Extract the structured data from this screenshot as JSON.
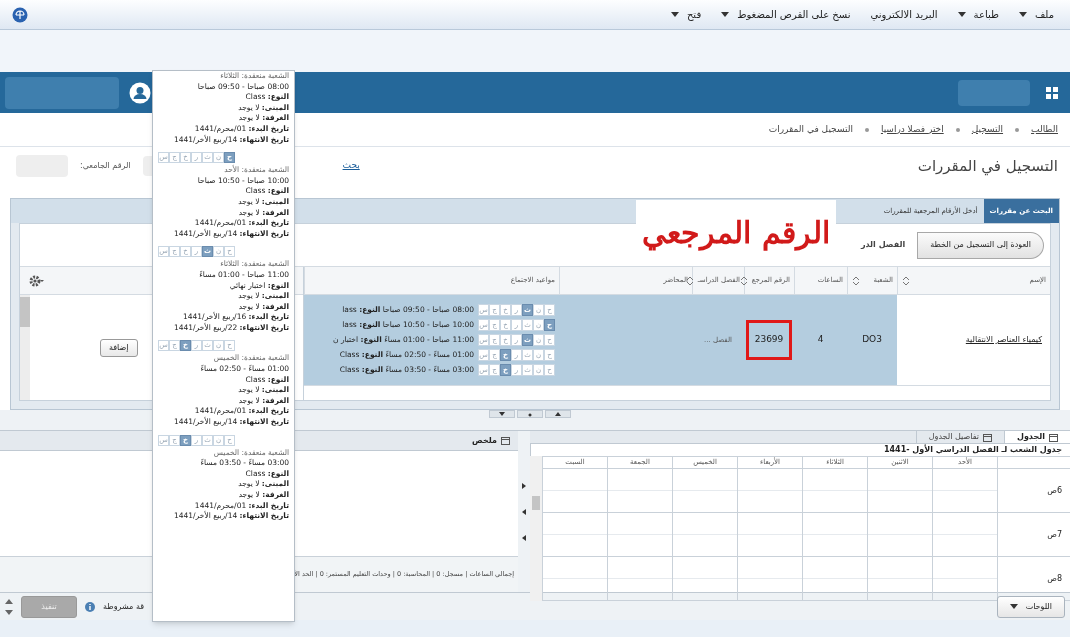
{
  "menu": [
    {
      "label": "ملف",
      "dropdown": true
    },
    {
      "label": "طباعة",
      "dropdown": true
    },
    {
      "label": "البريد الالكتروني",
      "dropdown": false
    },
    {
      "label": "نسخ على القرص المضغوط",
      "dropdown": true
    },
    {
      "label": "فتح",
      "dropdown": true
    }
  ],
  "breadcrumbs": [
    {
      "label": "الطالب",
      "link": true
    },
    {
      "label": "التسجيل",
      "link": true
    },
    {
      "label": "اختر فصلا دراسيا",
      "link": true
    },
    {
      "label": "التسجيل في المقررات",
      "link": false
    }
  ],
  "page_title": "التسجيل في المقررات",
  "student_id_label": "الرقم الجامعي:",
  "search_link": "بحث",
  "tabs": [
    {
      "label": "البحث عن مقررات",
      "selected": true
    },
    {
      "label": "أدخل الأرقام المرجعية للمقررات",
      "selected": false
    }
  ],
  "back_button": "العودة إلى التسجيل من الخطة",
  "term_label": "الفصل الدر",
  "annotation": "الرقم المرجعي",
  "table": {
    "columns": [
      "الإسم",
      "الشعبة",
      "الساعات",
      "الرقم المرجع",
      "الفصل الدراسـ",
      "المحاضر",
      "مواعيد الاجتماع"
    ],
    "rows": [
      {
        "name": "كيمياء العناصر الانتقالية",
        "section": "DO3",
        "hours": "4",
        "crn": "23699",
        "term": "الفصل ...",
        "selected": true,
        "meetings": [
          {
            "text": "08:00 صباحا - 09:50 صباحا **النوع:** lass",
            "days": [
              {
                "letter": "ح",
                "selected": false
              },
              {
                "letter": "ن",
                "selected": false
              },
              {
                "letter": "ث",
                "selected": true
              },
              {
                "letter": "ر",
                "selected": false
              },
              {
                "letter": "خ",
                "selected": false
              },
              {
                "letter": "ج",
                "selected": false
              },
              {
                "letter": "س",
                "selected": false
              }
            ]
          },
          {
            "text": "10:00 صباحا - 10:50 صباحا **النوع:** lass",
            "days": [
              {
                "letter": "ح",
                "selected": true
              },
              {
                "letter": "ن",
                "selected": false
              },
              {
                "letter": "ث",
                "selected": false
              },
              {
                "letter": "ر",
                "selected": false
              },
              {
                "letter": "خ",
                "selected": false
              },
              {
                "letter": "ج",
                "selected": false
              },
              {
                "letter": "س",
                "selected": false
              }
            ]
          },
          {
            "text": "11:00 صباحا - 01:00 مساءً **النوع:** اختبار ن",
            "days": [
              {
                "letter": "ح",
                "selected": false
              },
              {
                "letter": "ن",
                "selected": false
              },
              {
                "letter": "ث",
                "selected": true
              },
              {
                "letter": "ر",
                "selected": false
              },
              {
                "letter": "خ",
                "selected": false
              },
              {
                "letter": "ج",
                "selected": false
              },
              {
                "letter": "س",
                "selected": false
              }
            ]
          },
          {
            "text": "01:00 مساءً - 02:50 مساءً **النوع:** Class",
            "days": [
              {
                "letter": "ح",
                "selected": false
              },
              {
                "letter": "ن",
                "selected": false
              },
              {
                "letter": "ث",
                "selected": false
              },
              {
                "letter": "ر",
                "selected": false
              },
              {
                "letter": "خ",
                "selected": true
              },
              {
                "letter": "ج",
                "selected": false
              },
              {
                "letter": "س",
                "selected": false
              }
            ]
          },
          {
            "text": "03:00 مساءً - 03:50 مساءً **النوع:** Class",
            "days": [
              {
                "letter": "ح",
                "selected": false
              },
              {
                "letter": "ن",
                "selected": false
              },
              {
                "letter": "ث",
                "selected": false
              },
              {
                "letter": "ر",
                "selected": false
              },
              {
                "letter": "خ",
                "selected": true
              },
              {
                "letter": "ج",
                "selected": false
              },
              {
                "letter": "س",
                "selected": false
              }
            ]
          }
        ]
      }
    ]
  },
  "add_button": "إضافة",
  "tooltip": [
    {
      "lines": [
        "الشعبة منعقدة: الثلاثاء",
        "08:00 صباحا - 09:50 صباحا",
        "**النوع:** Class",
        "**المبنى:** لا يوجد",
        "**الغرفة:** لا يوجد",
        "**تاريخ البدء:** 01/محرم/1441",
        "**تاريخ الانتهاء:** 14/ربيع الأخر/1441"
      ]
    },
    {
      "days": [
        {
          "letter": "ح",
          "selected": true
        },
        {
          "letter": "ن",
          "selected": false
        },
        {
          "letter": "ث",
          "selected": false
        },
        {
          "letter": "ر",
          "selected": false
        },
        {
          "letter": "خ",
          "selected": false
        },
        {
          "letter": "ج",
          "selected": false
        },
        {
          "letter": "س",
          "selected": false
        }
      ],
      "lines": [
        "الشعبة منعقدة: الأحد",
        "10:00 صباحا - 10:50 صباحا",
        "**النوع:** Class",
        "**المبنى:** لا يوجد",
        "**الغرفة:** لا يوجد",
        "**تاريخ البدء:** 01/محرم/1441",
        "**تاريخ الانتهاء:** 14/ربيع الأخر/1441"
      ]
    },
    {
      "days": [
        {
          "letter": "ح",
          "selected": false
        },
        {
          "letter": "ن",
          "selected": false
        },
        {
          "letter": "ث",
          "selected": true
        },
        {
          "letter": "ر",
          "selected": false
        },
        {
          "letter": "خ",
          "selected": false
        },
        {
          "letter": "ج",
          "selected": false
        },
        {
          "letter": "س",
          "selected": false
        }
      ],
      "lines": [
        "الشعبة منعقدة: الثلاثاء",
        "11:00 صباحا - 01:00 مساءً",
        "**النوع:** اختبار نهائي",
        "**المبنى:** لا يوجد",
        "**الغرفة:** لا يوجد",
        "**تاريخ البدء:** 16/ربيع الأخر/1441",
        "**تاريخ الانتهاء:** 22/ربيع الأخر/1441"
      ]
    },
    {
      "days": [
        {
          "letter": "ح",
          "selected": false
        },
        {
          "letter": "ن",
          "selected": false
        },
        {
          "letter": "ث",
          "selected": false
        },
        {
          "letter": "ر",
          "selected": false
        },
        {
          "letter": "خ",
          "selected": true
        },
        {
          "letter": "ج",
          "selected": false
        },
        {
          "letter": "س",
          "selected": false
        }
      ],
      "lines": [
        "الشعبة منعقدة: الخميس",
        "01:00 مساءً - 02:50 مساءً",
        "**النوع:** Class",
        "**المبنى:** لا يوجد",
        "**الغرفة:** لا يوجد",
        "**تاريخ البدء:** 01/محرم/1441",
        "**تاريخ الانتهاء:** 14/ربيع الأخر/1441"
      ]
    },
    {
      "days": [
        {
          "letter": "ح",
          "selected": false
        },
        {
          "letter": "ن",
          "selected": false
        },
        {
          "letter": "ث",
          "selected": false
        },
        {
          "letter": "ر",
          "selected": false
        },
        {
          "letter": "خ",
          "selected": true
        },
        {
          "letter": "ج",
          "selected": false
        },
        {
          "letter": "س",
          "selected": false
        }
      ],
      "lines": [
        "الشعبة منعقدة: الخميس",
        "03:00 مساءً - 03:50 مساءً",
        "**النوع:** Class",
        "**المبنى:** لا يوجد",
        "**الغرفة:** لا يوجد",
        "**تاريخ البدء:** 01/محرم/1441",
        "**تاريخ الانتهاء:** 14/ربيع الأخر/1441"
      ]
    }
  ],
  "summary": {
    "title": "ملخص",
    "footer": "إجمالي الساعات | مسجل: 0 | المحاسبة: 0 | وحدات التعليم المستمر: 0 | الحد الأ"
  },
  "schedule": {
    "tabs": [
      {
        "label": "الجدول",
        "selected": true
      },
      {
        "label": "تفاصيل الجدول",
        "selected": false
      }
    ],
    "title": "جدول الشعب لـ الفصل الدراسي الأول -1441",
    "days": [
      "الأحد",
      "الاثنين",
      "الثلاثاء",
      "الأربعاء",
      "الخميس",
      "الجمعة",
      "السبت"
    ],
    "hours": [
      "6ص",
      "7ص",
      "8ص"
    ]
  },
  "panels_button": "اللوحات",
  "submit": {
    "label": "تنفيذ",
    "disabled": true
  },
  "conditional_text": "قة مشروطة"
}
